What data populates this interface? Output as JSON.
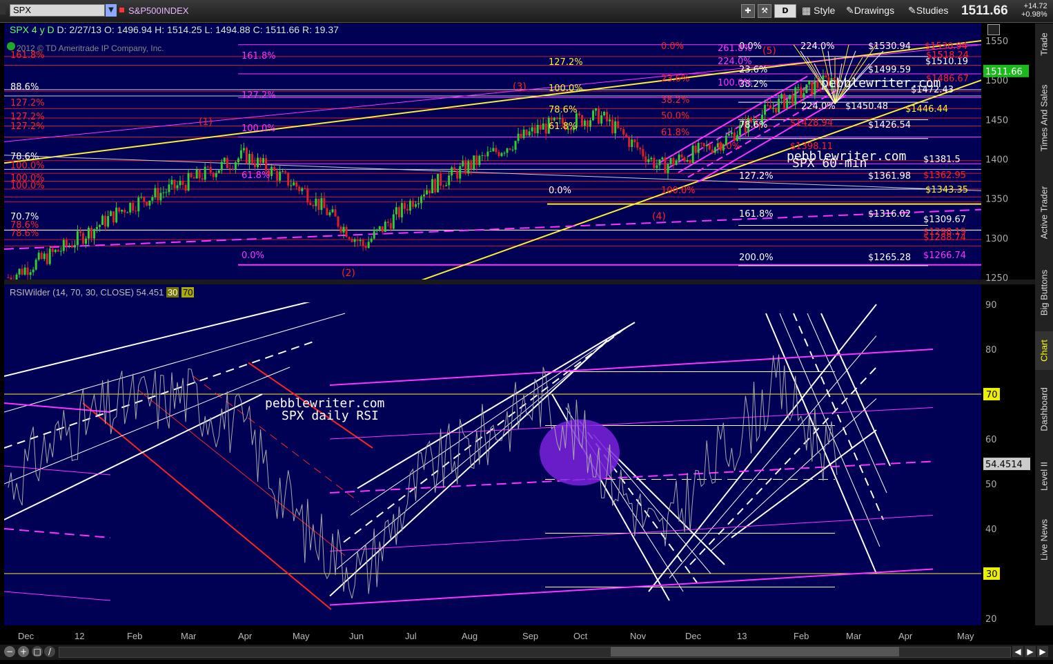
{
  "toolbar": {
    "symbol": "SPX",
    "description": "S&P500INDEX",
    "style_label": "Style",
    "drawings_label": "Drawings",
    "studies_label": "Studies",
    "d_label": "D",
    "last_price": "1511.66",
    "net_change": "+14.72",
    "pct_change": "+0.98%"
  },
  "status": {
    "symbol_period": "SPX 4 y D",
    "date": "D: 2/27/13",
    "open": "O: 1496.94",
    "high": "H: 1514.25",
    "low": "L: 1494.88",
    "close": "C: 1511.66",
    "range": "R: 19.37",
    "copyright": "2012 © TD Ameritrade IP Company, Inc."
  },
  "rsi_header": {
    "label": "RSIWilder (14, 70, 30, CLOSE)",
    "value": "54.451",
    "level30": "30",
    "level70": "70"
  },
  "price_axis": {
    "ticks": [
      "1550",
      "1500",
      "1450",
      "1400",
      "1350",
      "1300",
      "1250"
    ],
    "current": "1511.66"
  },
  "rsi_axis": {
    "ticks": [
      "90",
      "80",
      "70",
      "60",
      "50",
      "40",
      "30",
      "20"
    ],
    "current": "54.4514",
    "level70": "70",
    "level30": "30"
  },
  "side_tabs": [
    "Trade",
    "Times And Sales",
    "Active Trader",
    "Big Buttons",
    "Chart",
    "Dashboard",
    "Level II",
    "Live News"
  ],
  "time_axis": [
    "Dec",
    "12",
    "Feb",
    "Mar",
    "Apr",
    "May",
    "Jun",
    "Jul",
    "Aug",
    "Sep",
    "Oct",
    "Nov",
    "Dec",
    "13",
    "Feb",
    "Mar",
    "Apr",
    "May"
  ],
  "annotations": {
    "watermark_top_1": "pebblewriter.com",
    "watermark_top_2": "SPX 60-min",
    "watermark_rsi_1": "pebblewriter.com",
    "watermark_rsi_2": "SPX daily RSI",
    "wave_1": "(1)",
    "wave_2": "(2)",
    "wave_3": "(3)",
    "wave_4": "(4)",
    "wave_5": "(5)"
  },
  "fib_labels_left": [
    "161.8%",
    "88.6%",
    "127.2%",
    "127.2%",
    "127.2%",
    "78.6%",
    "100.0%",
    "100.0%",
    "100.0%",
    "70.7%",
    "78.6%",
    "78.6%"
  ],
  "fib_labels_mid_magenta": [
    "161.8%",
    "127.2%",
    "100.0%",
    "61.8%",
    "0.0%"
  ],
  "fib_labels_sep": [
    "127.2%",
    "100.0%",
    "78.6%",
    "61.8%",
    "0.0%"
  ],
  "fib_labels_right_white": [
    "0.0%",
    "23.6%",
    "38.2%",
    "78.6%",
    "127.2%",
    "161.8%",
    "200.0%",
    "224.0%"
  ],
  "price_labels_white": [
    "$1530.94",
    "$1510.19",
    "$1499.59",
    "$1472.43",
    "$1450.48",
    "$1446.44",
    "$1426.54",
    "$1381.5",
    "$1361.98",
    "$1343.35",
    "$1316.02",
    "$1309.67",
    "$1265.28"
  ],
  "price_labels_red": [
    "$1530.94",
    "$1518.24",
    "$1486.67",
    "$1428.94",
    "$1398.11",
    "$1362.95",
    "$1298.19",
    "$1288.74"
  ],
  "price_label_magenta": "$1266.74",
  "extra_labels": [
    "0.0%",
    "261.8%",
    "224.0%",
    "23.6%",
    "38.2%",
    "50.0%",
    "61.8%",
    "100.0%",
    "0.0%",
    "100.0%",
    "224.0%"
  ],
  "colors": {
    "panel_bg": "#000055",
    "candle_up": "#33cc33",
    "candle_down": "#dd2222",
    "fib_yellow": "#ffee33",
    "fib_magenta": "#ff33ff",
    "fib_red": "#ff2222",
    "rsi_line": "#aaaaaa",
    "accent_green": "#1db81d"
  },
  "chart_data": {
    "type": "line",
    "title": "SPX 4 y D",
    "price_ylim": [
      1240,
      1560
    ],
    "rsi_ylim": [
      20,
      90
    ],
    "x": [
      "Dec",
      "12",
      "Feb",
      "Mar",
      "Apr",
      "May",
      "Jun",
      "Jul",
      "Aug",
      "Sep",
      "Oct",
      "Nov",
      "Dec",
      "13",
      "Feb"
    ],
    "series": [
      {
        "name": "SPX",
        "values": [
          1250,
          1290,
          1340,
          1370,
          1405,
          1360,
          1290,
          1360,
          1400,
          1440,
          1455,
          1390,
          1420,
          1470,
          1505
        ]
      },
      {
        "name": "RSIWilder (14, 70, 30, CLOSE)",
        "values": [
          50,
          62,
          68,
          70,
          62,
          40,
          30,
          52,
          60,
          70,
          55,
          38,
          56,
          72,
          54.45
        ]
      }
    ]
  }
}
